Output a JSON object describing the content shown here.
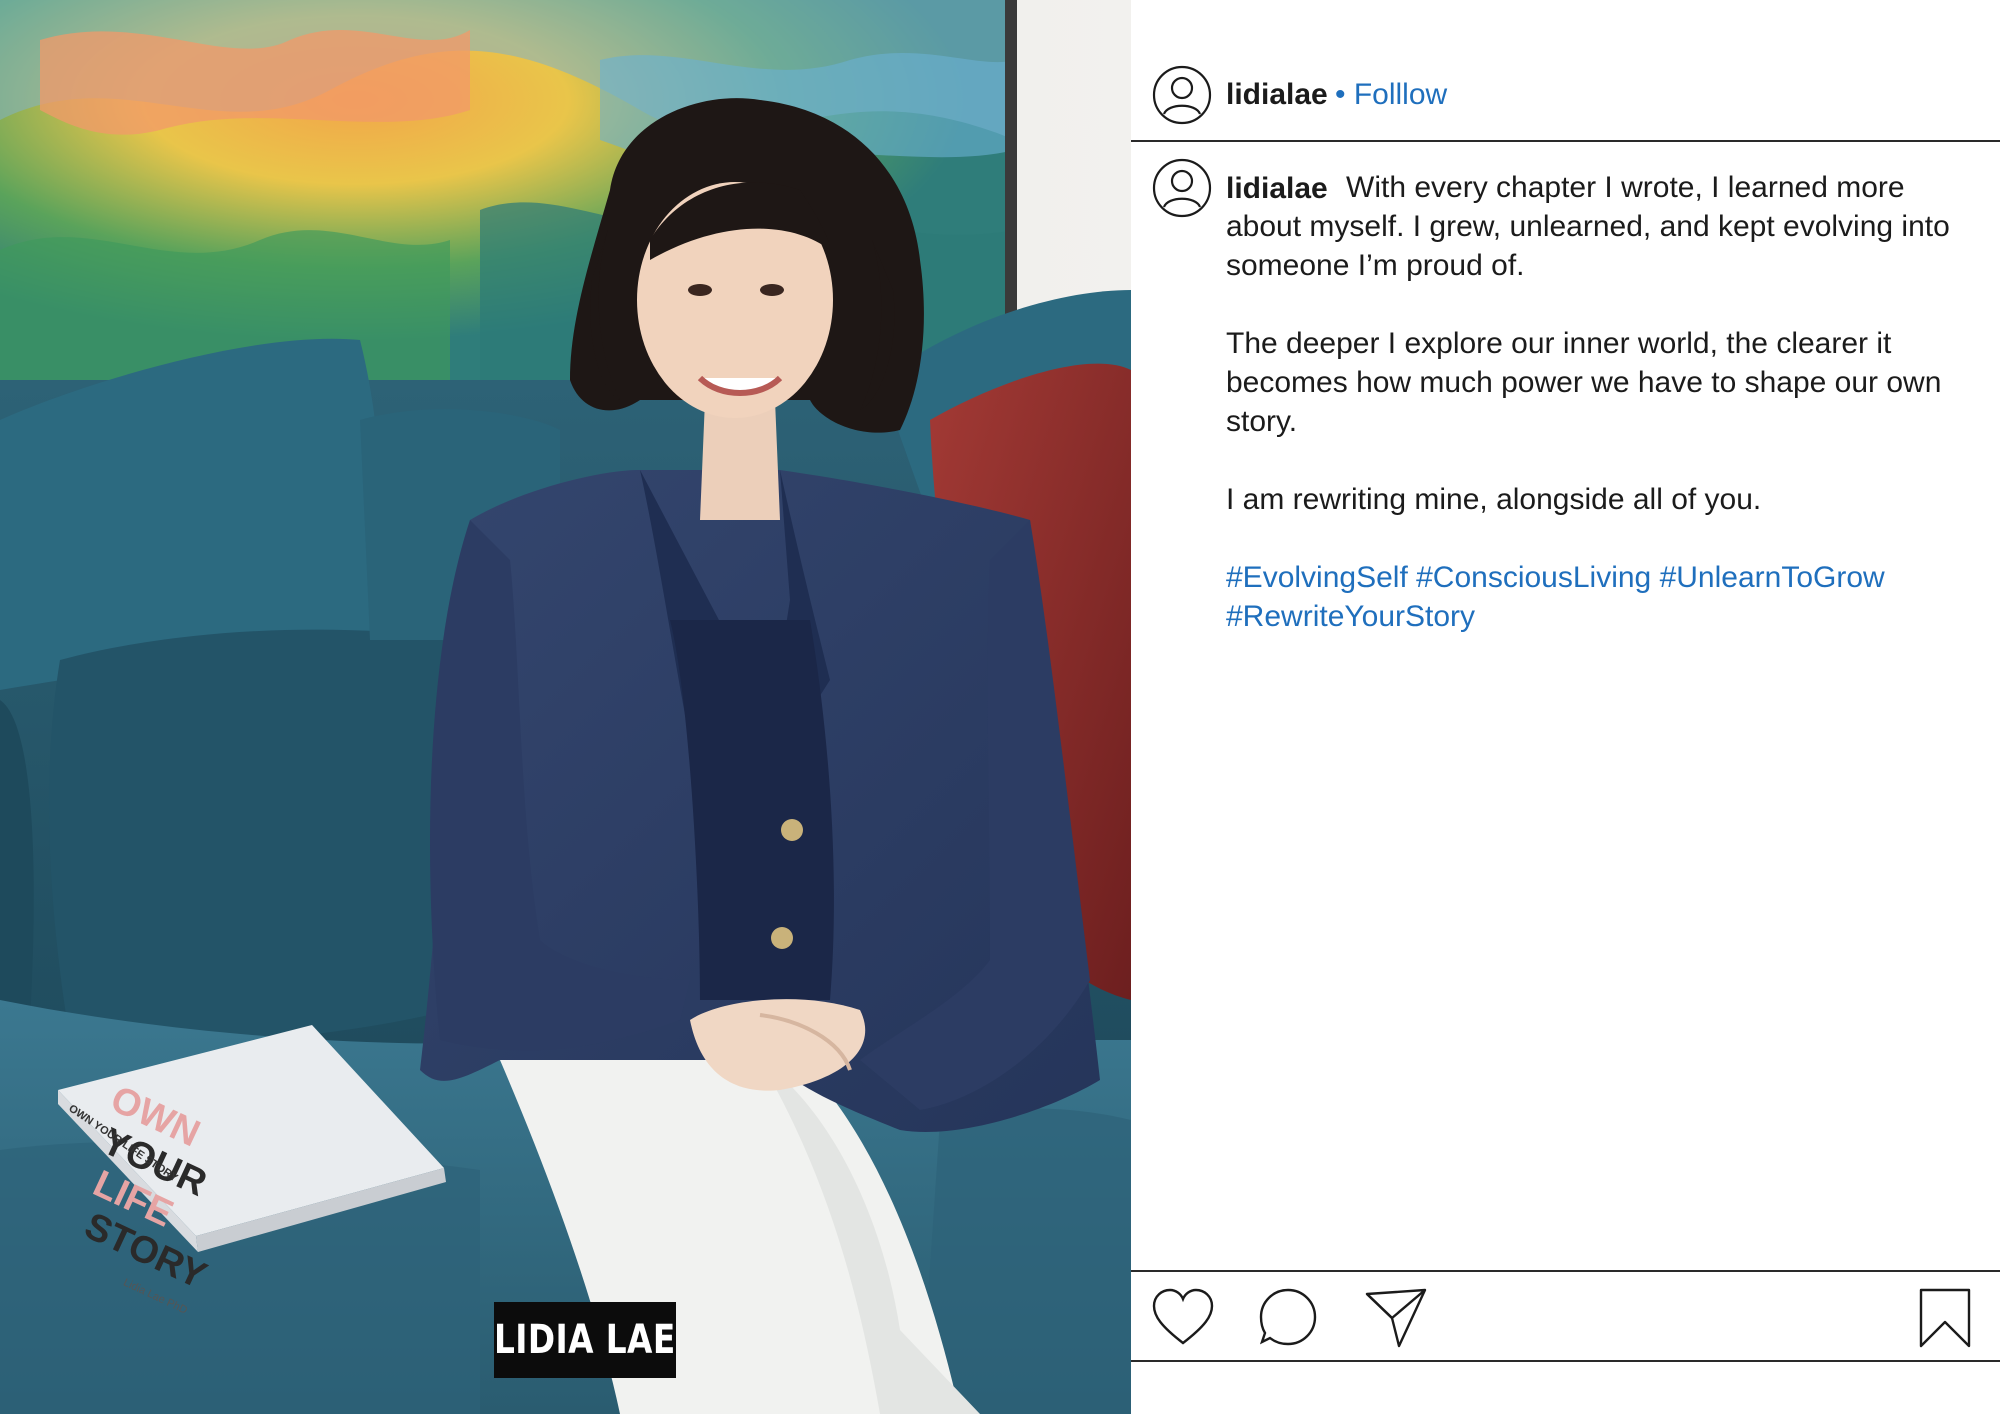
{
  "photo": {
    "alt": "Woman in navy blazer seated on teal sofa holding hands, book beside her",
    "watermark": "LIDIA LAE",
    "book": {
      "title_lines": [
        "OWN",
        "YOUR",
        "LIFE",
        "STORY"
      ],
      "spine_text": "OWN YOUR LIFE STORY",
      "author": "Lidia Lae PhD"
    }
  },
  "post": {
    "username": "lidialae",
    "follow_label": "• Folllow",
    "caption": {
      "line1": "With every chapter I wrote, I learned more about myself. I grew, unlearned, and kept evolving into someone I’m proud of.",
      "line2": "The deeper I explore our inner world, the clearer it becomes how much power we have to shape our own story.",
      "line3": "I am rewriting mine, alongside all of you.",
      "hashtags": "#EvolvingSelf #ConsciousLiving #UnlearnToGrow #RewriteYourStory"
    }
  },
  "icons": {
    "avatar": "user-circle-icon",
    "like": "heart-icon",
    "comment": "speech-bubble-icon",
    "share": "paper-plane-icon",
    "save": "bookmark-icon"
  },
  "colors": {
    "link": "#1f6fbd",
    "text": "#1b1b1b",
    "sofa": "#2b5a6c",
    "blazer": "#2a3a5e"
  }
}
